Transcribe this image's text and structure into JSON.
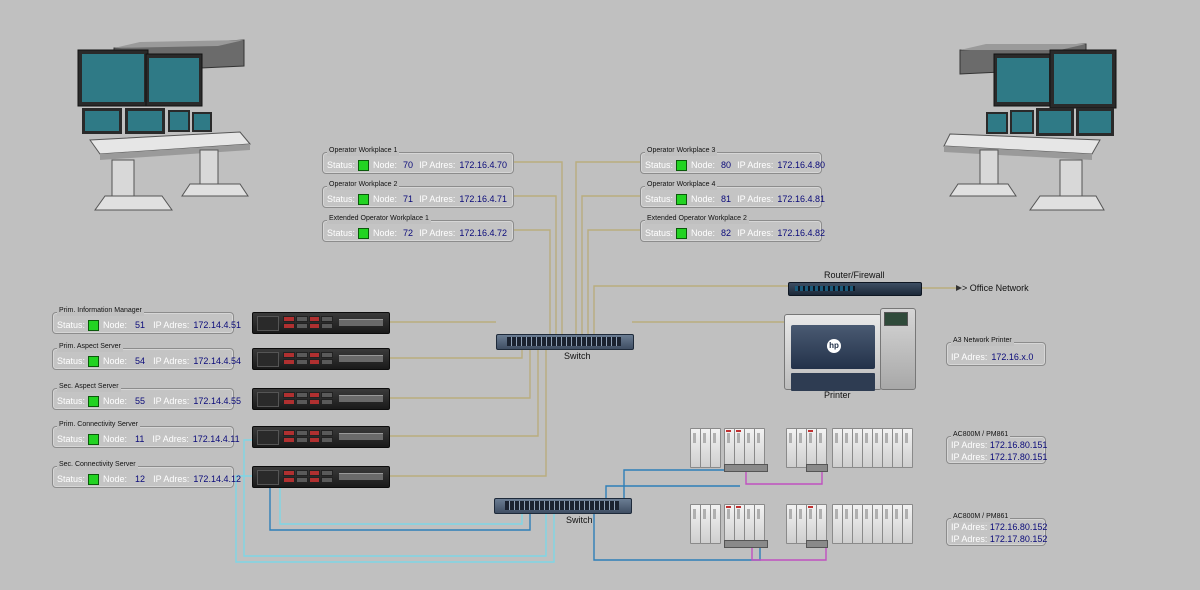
{
  "workplaces_left": [
    {
      "title": "Operator Workplace 1",
      "status_label": "Status:",
      "node_label": "Node:",
      "node": "70",
      "ip_label": "IP Adres:",
      "ip": "172.16.4.70"
    },
    {
      "title": "Operator Workplace 2",
      "status_label": "Status:",
      "node_label": "Node:",
      "node": "71",
      "ip_label": "IP Adres:",
      "ip": "172.16.4.71"
    },
    {
      "title": "Extended Operator Workplace 1",
      "status_label": "Status:",
      "node_label": "Node:",
      "node": "72",
      "ip_label": "IP Adres:",
      "ip": "172.16.4.72"
    }
  ],
  "workplaces_right": [
    {
      "title": "Operator Workplace 3",
      "status_label": "Status:",
      "node_label": "Node:",
      "node": "80",
      "ip_label": "IP Adres:",
      "ip": "172.16.4.80"
    },
    {
      "title": "Operator Workplace 4",
      "status_label": "Status:",
      "node_label": "Node:",
      "node": "81",
      "ip_label": "IP Adres:",
      "ip": "172.16.4.81"
    },
    {
      "title": "Extended Operator Workplace 2",
      "status_label": "Status:",
      "node_label": "Node:",
      "node": "82",
      "ip_label": "IP Adres:",
      "ip": "172.16.4.82"
    }
  ],
  "servers": [
    {
      "title": "Prim. Information Manager",
      "status_label": "Status:",
      "node_label": "Node:",
      "node": "51",
      "ip_label": "IP Adres:",
      "ip": "172.14.4.51"
    },
    {
      "title": "Prim. Aspect Server",
      "status_label": "Status:",
      "node_label": "Node:",
      "node": "54",
      "ip_label": "IP Adres:",
      "ip": "172.14.4.54"
    },
    {
      "title": "Sec. Aspect Server",
      "status_label": "Status:",
      "node_label": "Node:",
      "node": "55",
      "ip_label": "IP Adres:",
      "ip": "172.14.4.55"
    },
    {
      "title": "Prim. Connectivity Server",
      "status_label": "Status:",
      "node_label": "Node:",
      "node": "11",
      "ip_label": "IP Adres:",
      "ip": "172.14.4.11"
    },
    {
      "title": "Sec. Connectivity Server",
      "status_label": "Status:",
      "node_label": "Node:",
      "node": "12",
      "ip_label": "IP Adres:",
      "ip": "172.14.4.12"
    }
  ],
  "switch_top_label": "Switch",
  "switch_bottom_label": "Switch",
  "router_label": "Router/Firewall",
  "office_network_label": "> Office Network",
  "printer_label": "Printer",
  "printer_logo": "hp",
  "network_printer": {
    "title": "A3 Network Printer",
    "ip_label": "IP Adres:",
    "ip": "172.16.x.0"
  },
  "controllers": [
    {
      "title": "AC800M / PM861",
      "ip_label": "IP Adres:",
      "ip1": "172.16.80.151",
      "ip2": "172.17.80.151"
    },
    {
      "title": "AC800M / PM861",
      "ip_label": "IP Adres:",
      "ip1": "172.16.80.152",
      "ip2": "172.17.80.152"
    }
  ],
  "colors": {
    "background": "#c0c0c0",
    "status_ok": "#22d322",
    "value_text": "#0a0a7a",
    "wire_primary": "#b9ad7e",
    "wire_secondary": "#2e7fb8",
    "wire_secondary_light": "#7fd6e6",
    "wire_controller_link": "#c050c0"
  },
  "icons": [
    "operator-console-icon",
    "server-icon",
    "network-switch-icon",
    "router-icon",
    "printer-icon",
    "controller-rack-icon"
  ]
}
